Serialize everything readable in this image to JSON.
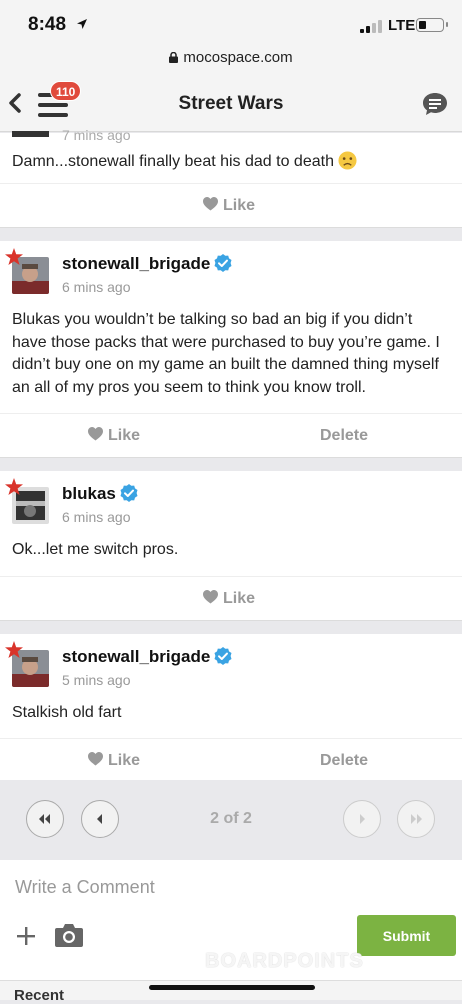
{
  "status_bar": {
    "time": "8:48",
    "network": "LTE",
    "battery_level": 0.3
  },
  "browser": {
    "url": "mocospace.com"
  },
  "header": {
    "title": "Street Wars",
    "notification_count": "110"
  },
  "partial_post": {
    "time_ago": "7 mins ago",
    "text": "Damn...stonewall finally beat his dad to death",
    "like_label": "Like"
  },
  "posts": [
    {
      "username": "stonewall_brigade",
      "time_ago": "6 mins ago",
      "text": "Blukas you wouldn’t be talking so bad an big if you didn’t have those packs that were purchased to buy you’re game. I didn’t buy one on my game an built the damned thing myself an all of my pros you seem to think you know troll.",
      "like_label": "Like",
      "delete_label": "Delete"
    },
    {
      "username": "blukas",
      "time_ago": "6 mins ago",
      "text": "Ok...let me switch pros.",
      "like_label": "Like"
    },
    {
      "username": "stonewall_brigade",
      "time_ago": "5 mins ago",
      "text": "Stalkish old fart",
      "like_label": "Like",
      "delete_label": "Delete"
    }
  ],
  "pagination": {
    "label": "2 of 2"
  },
  "composer": {
    "placeholder": "Write a Comment",
    "submit_label": "Submit",
    "watermark": "BOARDPOINTS"
  },
  "bottom_peek": {
    "text": "Recent"
  },
  "colors": {
    "accent_green": "#7cb342",
    "badge_red": "#e04a3c",
    "verified_blue": "#3aa3e3",
    "star_red": "#d9342b"
  }
}
